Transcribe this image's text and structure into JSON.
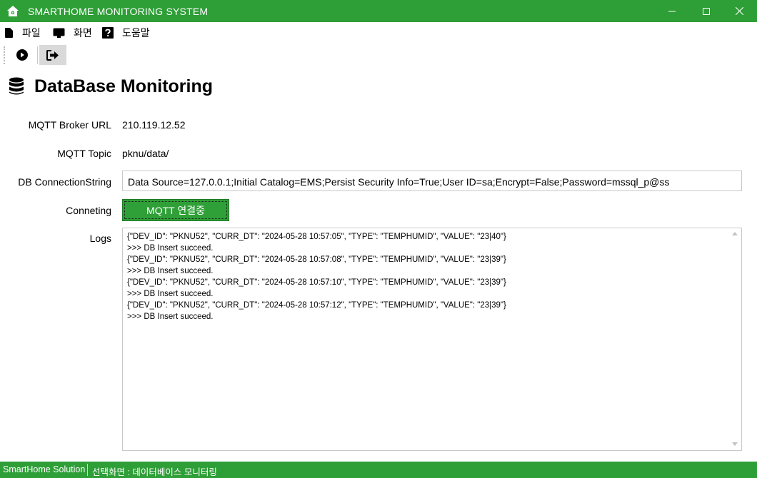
{
  "window": {
    "title": "SMARTHOME MONITORING SYSTEM"
  },
  "menu": {
    "file": "파일",
    "view": "화면",
    "help": "도움말"
  },
  "header": {
    "title": "DataBase Monitoring"
  },
  "form": {
    "broker_label": "MQTT Broker URL",
    "broker_value": "210.119.12.52",
    "topic_label": "MQTT Topic",
    "topic_value": "pknu/data/",
    "conn_label": "DB ConnectionString",
    "conn_value": "Data Source=127.0.0.1;Initial Catalog=EMS;Persist Security Info=True;User ID=sa;Encrypt=False;Password=mssql_p@ss",
    "connecting_label": "Conneting",
    "mqtt_button": "MQTT 연결중",
    "logs_label": "Logs"
  },
  "logs": [
    "{\"DEV_ID\": \"PKNU52\", \"CURR_DT\": \"2024-05-28 10:57:05\", \"TYPE\": \"TEMPHUMID\", \"VALUE\": \"23|40\"}",
    ">>> DB Insert succeed.",
    "{\"DEV_ID\": \"PKNU52\", \"CURR_DT\": \"2024-05-28 10:57:08\", \"TYPE\": \"TEMPHUMID\", \"VALUE\": \"23|39\"}",
    ">>> DB Insert succeed.",
    "{\"DEV_ID\": \"PKNU52\", \"CURR_DT\": \"2024-05-28 10:57:10\", \"TYPE\": \"TEMPHUMID\", \"VALUE\": \"23|39\"}",
    ">>> DB Insert succeed.",
    "{\"DEV_ID\": \"PKNU52\", \"CURR_DT\": \"2024-05-28 10:57:12\", \"TYPE\": \"TEMPHUMID\", \"VALUE\": \"23|39\"}",
    ">>> DB Insert succeed."
  ],
  "status": {
    "left": "SmartHome Solution",
    "right": "선택화면 : 데이터베이스 모니터링"
  },
  "colors": {
    "accent": "#2e9e37",
    "button": "#2fa037"
  },
  "icons": {
    "app": "smarthome-icon",
    "file": "file-icon",
    "view": "monitor-icon",
    "help": "question-icon",
    "play": "play-circle-icon",
    "exit": "exit-icon",
    "database": "database-icon"
  }
}
